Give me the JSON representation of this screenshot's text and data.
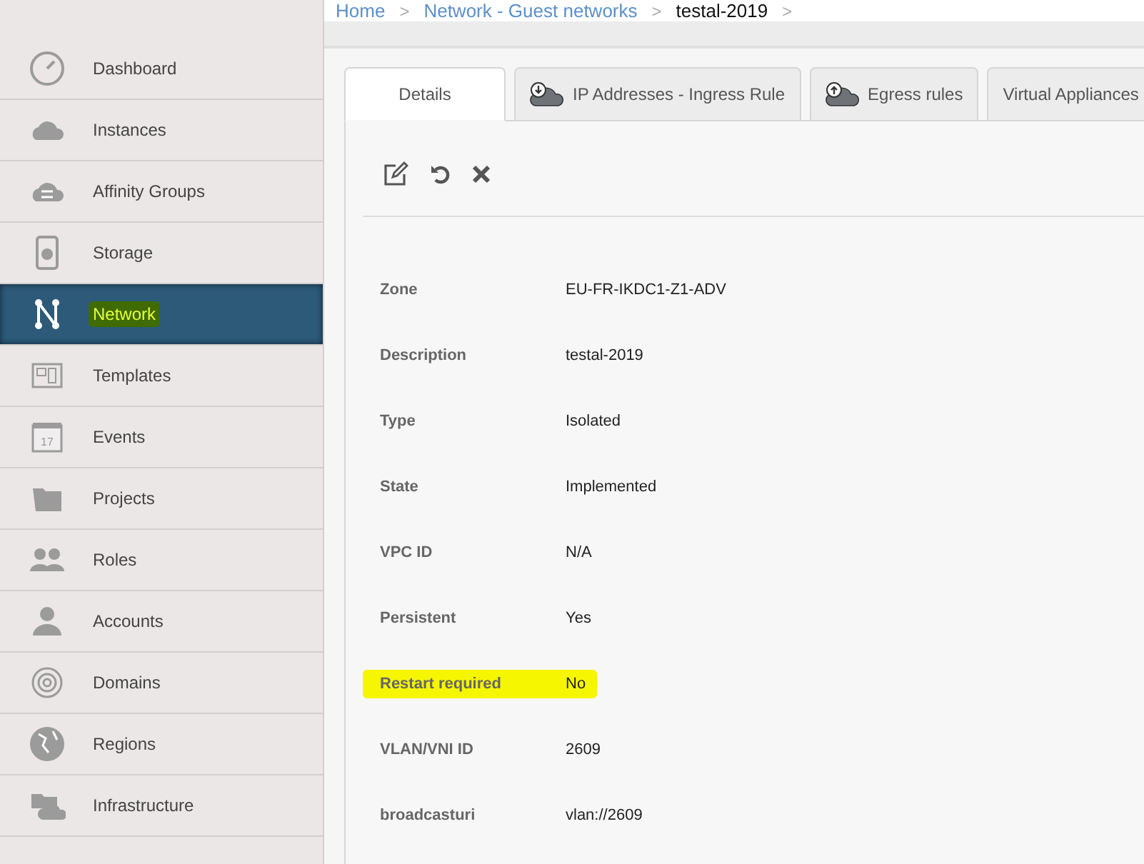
{
  "sidebar": {
    "items": [
      {
        "kind": "dashboard",
        "label": "Dashboard",
        "selected": false,
        "highlighted": false
      },
      {
        "kind": "instances",
        "label": "Instances",
        "selected": false,
        "highlighted": false
      },
      {
        "kind": "affinity",
        "label": "Affinity Groups",
        "selected": false,
        "highlighted": false
      },
      {
        "kind": "storage",
        "label": "Storage",
        "selected": false,
        "highlighted": false
      },
      {
        "kind": "network",
        "label": "Network",
        "selected": true,
        "highlighted": true
      },
      {
        "kind": "templates",
        "label": "Templates",
        "selected": false,
        "highlighted": false
      },
      {
        "kind": "events",
        "label": "Events",
        "selected": false,
        "highlighted": false,
        "icon_text": "17"
      },
      {
        "kind": "projects",
        "label": "Projects",
        "selected": false,
        "highlighted": false
      },
      {
        "kind": "roles",
        "label": "Roles",
        "selected": false,
        "highlighted": false
      },
      {
        "kind": "accounts",
        "label": "Accounts",
        "selected": false,
        "highlighted": false
      },
      {
        "kind": "domains",
        "label": "Domains",
        "selected": false,
        "highlighted": false
      },
      {
        "kind": "regions",
        "label": "Regions",
        "selected": false,
        "highlighted": false
      },
      {
        "kind": "infrastructure",
        "label": "Infrastructure",
        "selected": false,
        "highlighted": false
      }
    ]
  },
  "breadcrumb": [
    {
      "label": "Home",
      "link": true
    },
    {
      "label": "Network - Guest networks",
      "link": true
    },
    {
      "label": "testal-2019",
      "link": false
    }
  ],
  "breadcrumb_separator": ">",
  "tabs": [
    {
      "label": "Details",
      "selected": true,
      "kind": "plain"
    },
    {
      "label": "IP Addresses - Ingress Rule",
      "selected": false,
      "kind": "ingress"
    },
    {
      "label": "Egress rules",
      "selected": false,
      "kind": "egress"
    },
    {
      "label": "Virtual Appliances",
      "selected": false,
      "kind": "plain"
    }
  ],
  "actions": [
    {
      "kind": "edit"
    },
    {
      "kind": "restart"
    },
    {
      "kind": "remove"
    }
  ],
  "details": [
    {
      "label": "Zone",
      "value": "EU-FR-IKDC1-Z1-ADV",
      "highlighted": false
    },
    {
      "label": "Description",
      "value": "testal-2019",
      "highlighted": false
    },
    {
      "label": "Type",
      "value": "Isolated",
      "highlighted": false
    },
    {
      "label": "State",
      "value": "Implemented",
      "highlighted": false
    },
    {
      "label": "VPC ID",
      "value": "N/A",
      "highlighted": false
    },
    {
      "label": "Persistent",
      "value": "Yes",
      "highlighted": false
    },
    {
      "label": "Restart required",
      "value": "No",
      "highlighted": true
    },
    {
      "label": "VLAN/VNI ID",
      "value": "2609",
      "highlighted": false
    },
    {
      "label": "broadcasturi",
      "value": "vlan://2609",
      "highlighted": false
    }
  ]
}
